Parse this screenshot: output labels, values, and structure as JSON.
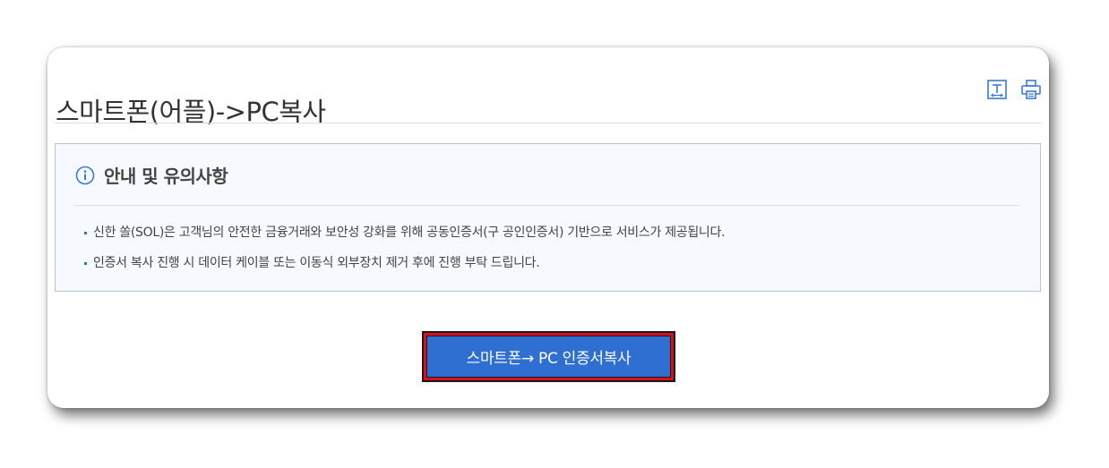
{
  "page": {
    "title": "스마트폰(어플)->PC복사"
  },
  "toolbar": {
    "items": [
      {
        "icon": "text-size-icon"
      },
      {
        "icon": "print-icon"
      }
    ]
  },
  "notice": {
    "icon": "info-circle-icon",
    "title": "안내 및 유의사항",
    "items": [
      "신한 쏠(SOL)은 고객님의 안전한 금융거래와 보안성 강화를 위해 공동인증서(구 공인인증서) 기반으로 서비스가 제공됩니다.",
      "인증서 복사 진행 시 데이터 케이블 또는 이동식 외부장치 제거 후에 진행 부탁 드립니다."
    ]
  },
  "action": {
    "button_label": "스마트폰→ PC 인증서복사"
  },
  "colors": {
    "accent": "#2e6fd1",
    "highlight_border": "#d6101c",
    "notice_background": "#f6f9fd"
  }
}
